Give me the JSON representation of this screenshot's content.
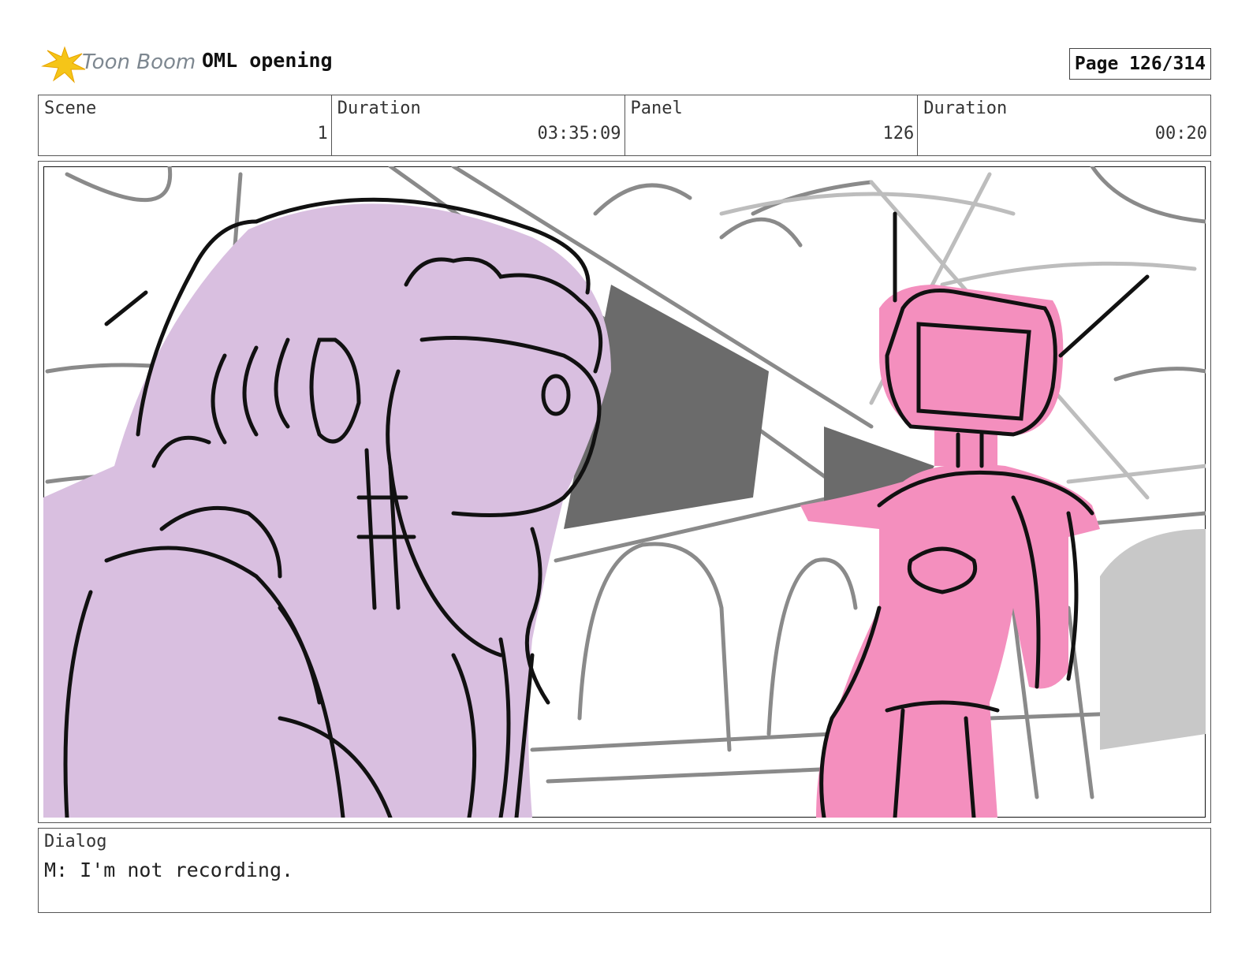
{
  "header": {
    "logo_text": "Toon Boom",
    "title": "OML opening",
    "page": "Page 126/314"
  },
  "info": {
    "scene_label": "Scene",
    "scene_value": "1",
    "duration_label": "Duration",
    "duration_value": "03:35:09",
    "panel_label": "Panel",
    "panel_value": "126",
    "panel_duration_label": "Duration",
    "panel_duration_value": "00:20"
  },
  "dialog": {
    "label": "Dialog",
    "text": "M: I'm not recording."
  },
  "colors": {
    "character_left": "#d9bfe0",
    "character_right": "#f48fbe",
    "background_line": "#8a8a8a",
    "shadow": "#6b6b6b",
    "logo_star": "#f5c518"
  }
}
